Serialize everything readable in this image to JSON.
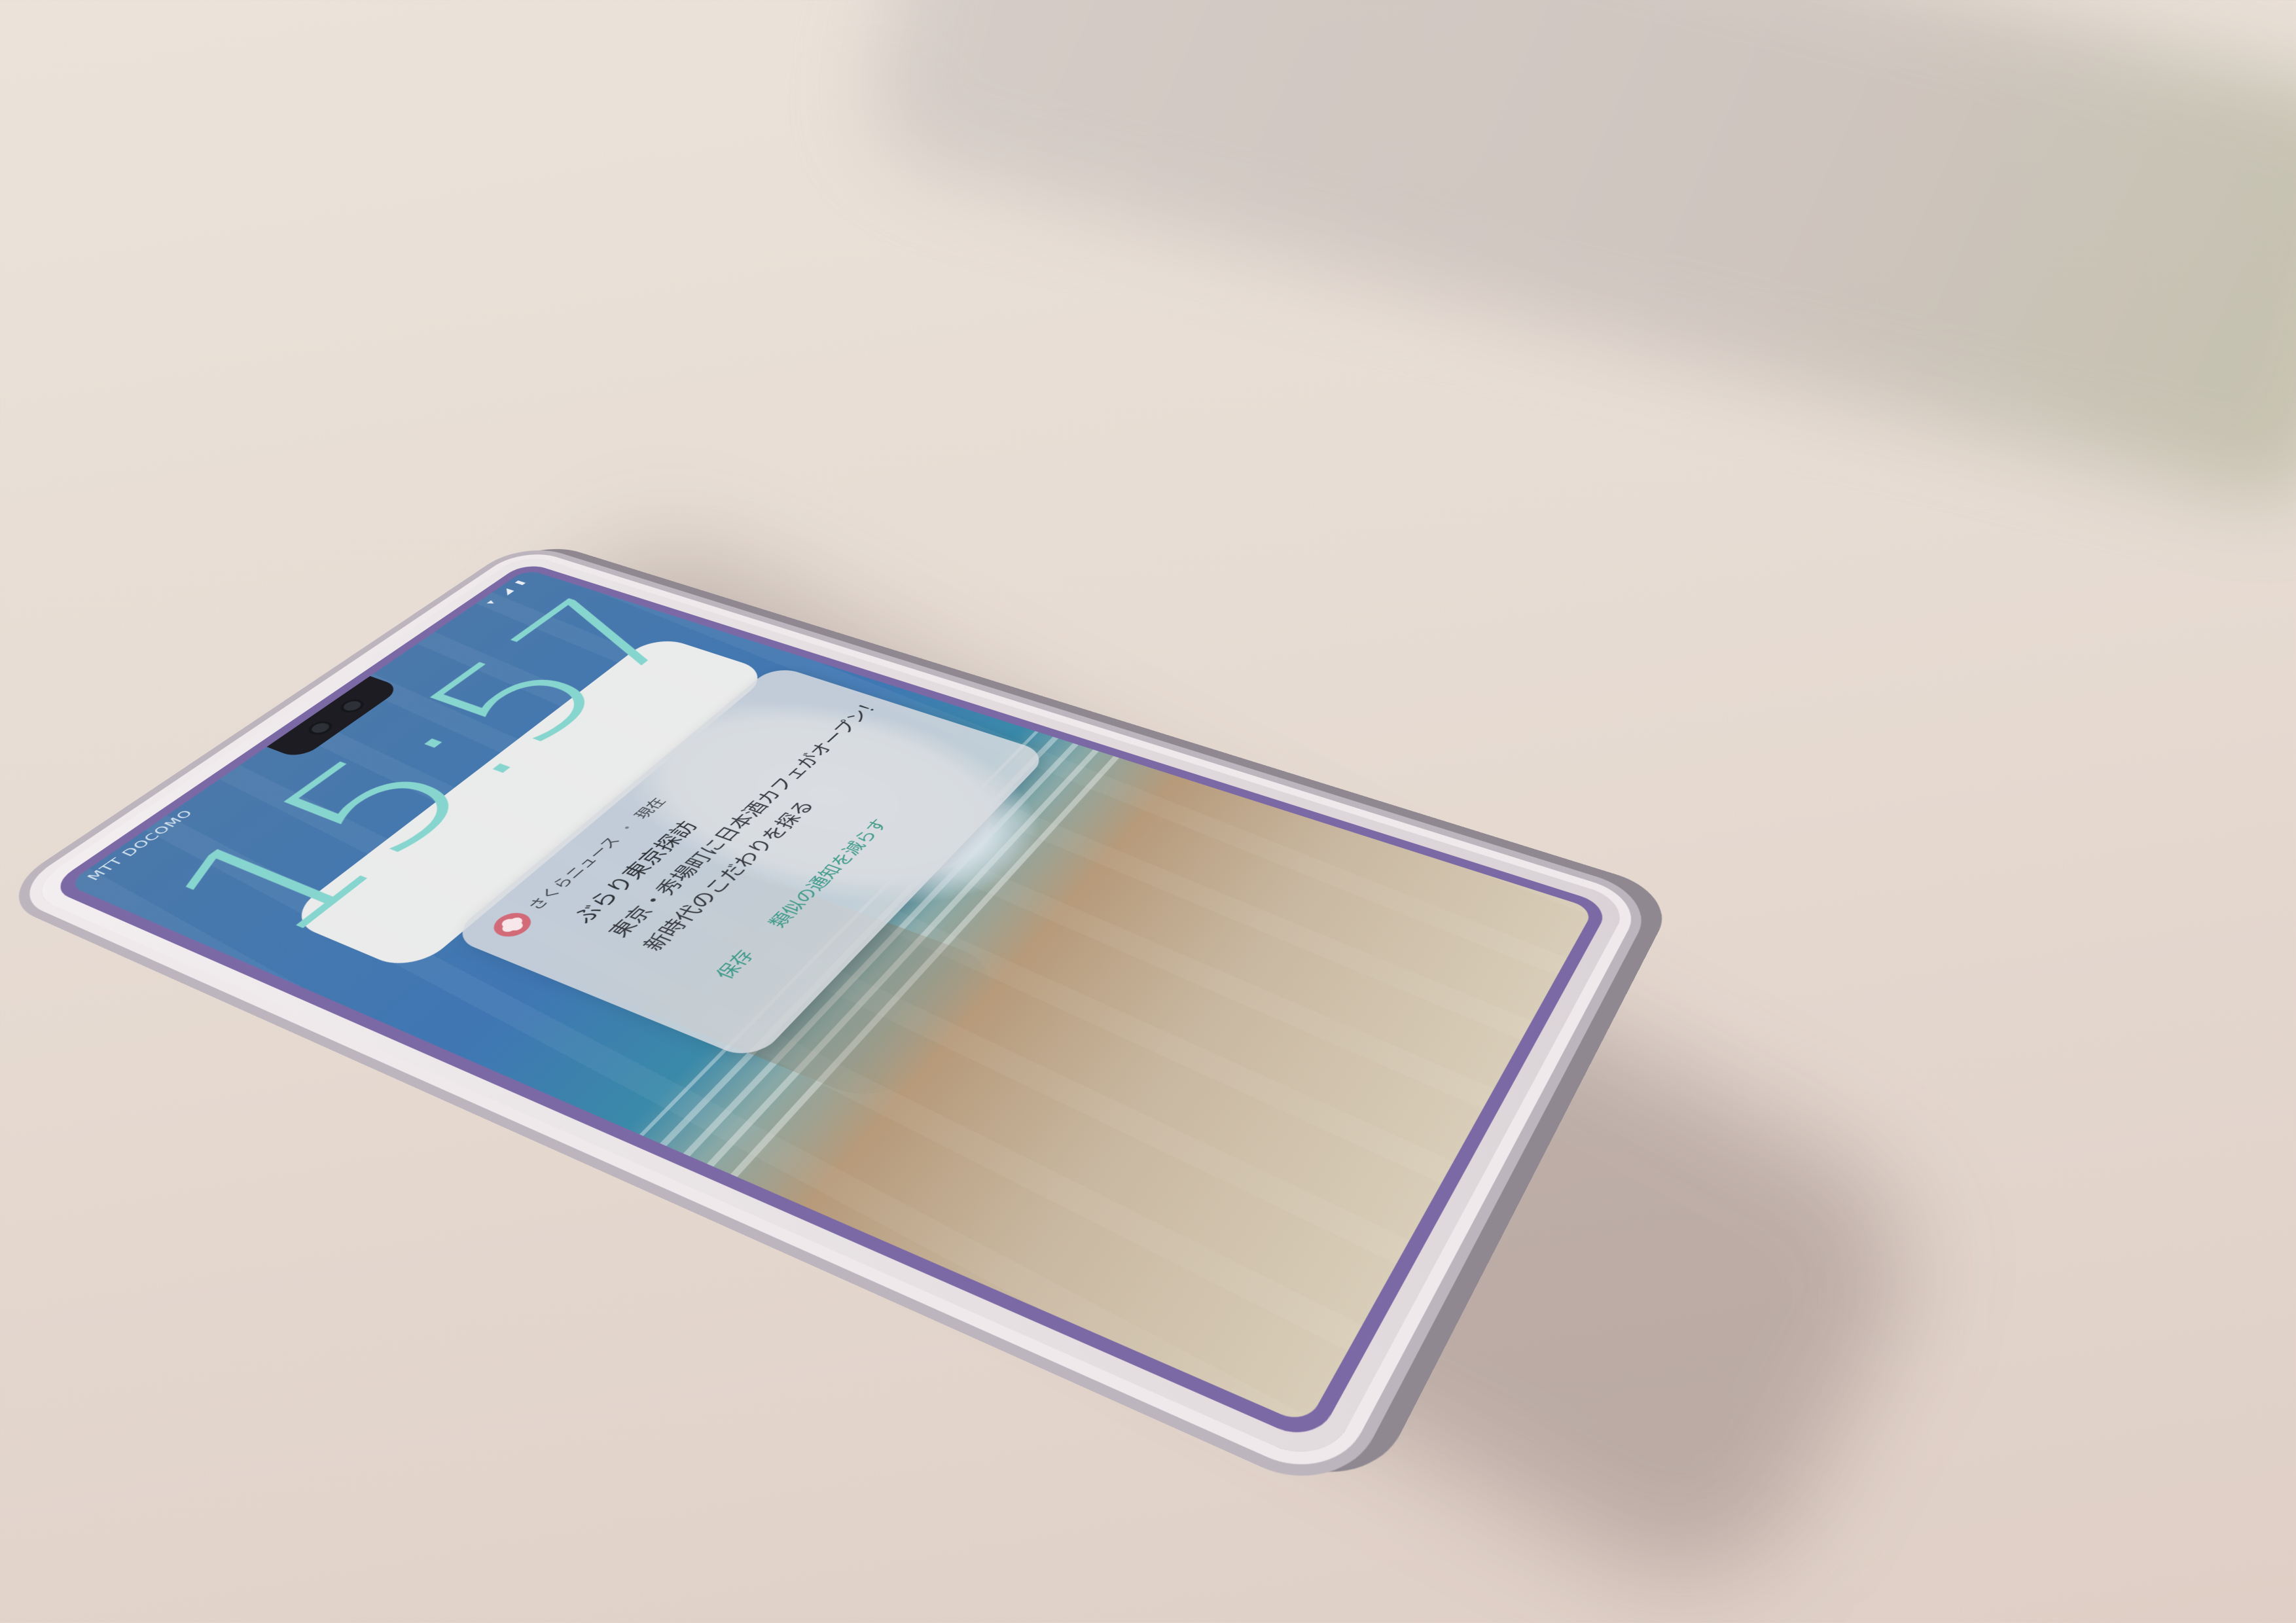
{
  "status_bar": {
    "carrier": "MTT DOCOMO",
    "icons": [
      "wifi-icon",
      "signal-icon",
      "battery-icon"
    ]
  },
  "lock_screen": {
    "time": "15:57"
  },
  "notification": {
    "app_name": "さくらニュース",
    "separator": "・",
    "time_label": "現在",
    "title": "ぶらり東京探訪",
    "line1": "東京・秀場町に日本酒カフェがオープン！",
    "line2": "新時代のこだわりを探る",
    "actions": [
      "保存",
      "類似の通知を減らす"
    ],
    "accent_color": "#3f9a8a",
    "app_icon_color": "#d26a78"
  },
  "colors": {
    "frame": "#7b69a6",
    "clock": "#86d6cf"
  }
}
